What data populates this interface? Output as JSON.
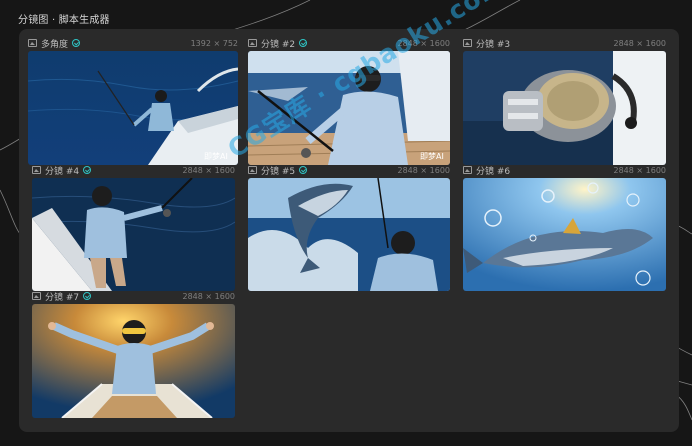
{
  "page_title": "分镜图 · 脚本生成器",
  "cards": [
    {
      "label": "多角度",
      "size": "1392 × 752",
      "checked": true,
      "scene": "boat-fishing-rear"
    },
    {
      "label": "分镜 #2",
      "size": "2848 × 1600",
      "checked": true,
      "scene": "man-sunglasses-rod"
    },
    {
      "label": "分镜 #3",
      "size": "2848 × 1600",
      "checked": false,
      "scene": "fishing-reel-closeup"
    },
    {
      "label": "分镜 #4",
      "size": "2848 × 1600",
      "checked": true,
      "scene": "man-reeling-boat"
    },
    {
      "label": "分镜 #5",
      "size": "2848 × 1600",
      "checked": true,
      "scene": "tuna-jumping"
    },
    {
      "label": "分镜 #6",
      "size": "2848 × 1600",
      "checked": false,
      "scene": "tuna-underwater-bubbles"
    },
    {
      "label": "分镜 #7",
      "size": "2848 × 1600",
      "checked": true,
      "scene": "man-celebrating-boat"
    }
  ],
  "watermarks": {
    "thumb1": "即梦AI",
    "thumb2": "即梦AI",
    "site": "CG宝库 · cgbaoku.com"
  }
}
